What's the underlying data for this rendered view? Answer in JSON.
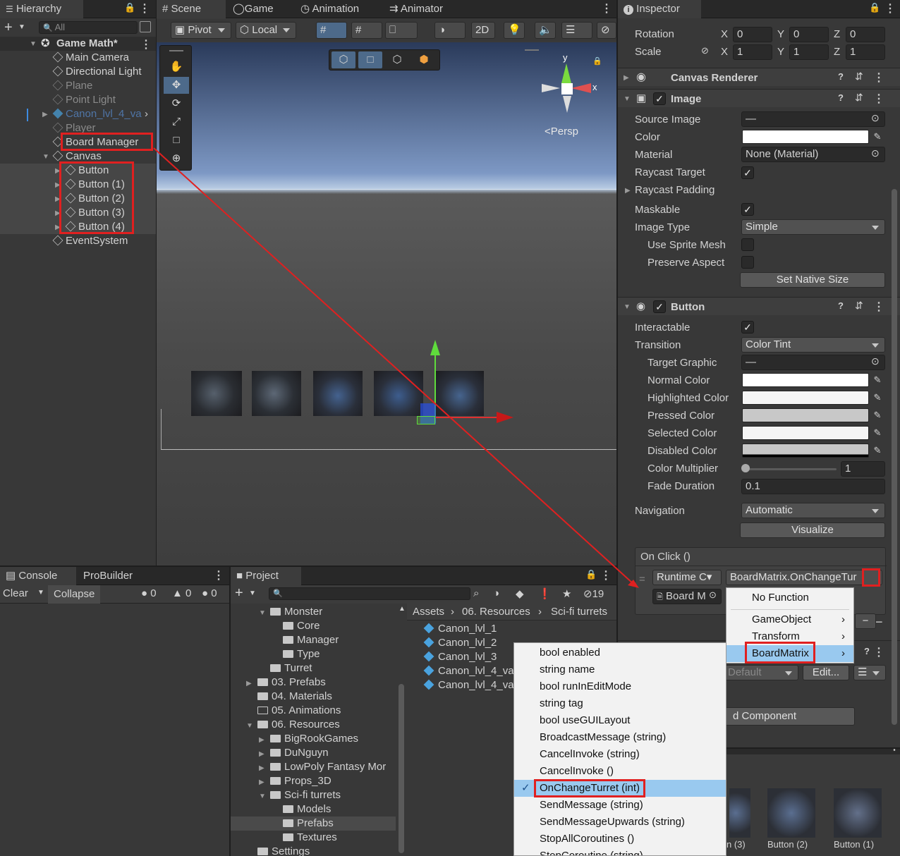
{
  "hierarchy": {
    "tab": "Hierarchy",
    "search_placeholder": "All",
    "scene_name": "Game Math*",
    "items": [
      {
        "label": "Main Camera"
      },
      {
        "label": "Directional Light"
      },
      {
        "label": "Plane"
      },
      {
        "label": "Point Light"
      },
      {
        "label": "Canon_lvl_4_va"
      },
      {
        "label": "Player"
      },
      {
        "label": "Board Manager"
      },
      {
        "label": "Canvas"
      },
      {
        "label": "Button"
      },
      {
        "label": "Button (1)"
      },
      {
        "label": "Button (2)"
      },
      {
        "label": "Button (3)"
      },
      {
        "label": "Button (4)"
      },
      {
        "label": "EventSystem"
      }
    ]
  },
  "scene": {
    "tabs": [
      "Scene",
      "Game",
      "Animation",
      "Animator"
    ],
    "pivot": "Pivot",
    "local": "Local",
    "mode_2d": "2D",
    "persp": "Persp",
    "gizmo_y": "y",
    "gizmo_x": "x"
  },
  "inspector": {
    "tab": "Inspector",
    "rotation_label": "Rotation",
    "rotation": {
      "x": "0",
      "y": "0",
      "z": "0"
    },
    "scale_label": "Scale",
    "scale": {
      "x": "1",
      "y": "1",
      "z": "1"
    },
    "axis": {
      "x": "X",
      "y": "Y",
      "z": "Z"
    },
    "canvas_renderer": "Canvas Renderer",
    "image": {
      "title": "Image",
      "source_image_label": "Source Image",
      "source_image_value": "—",
      "color_label": "Color",
      "material_label": "Material",
      "material_value": "None (Material)",
      "raycast_target_label": "Raycast Target",
      "raycast_padding_label": "Raycast Padding",
      "maskable_label": "Maskable",
      "image_type_label": "Image Type",
      "image_type_value": "Simple",
      "use_sprite_mesh_label": "Use Sprite Mesh",
      "preserve_aspect_label": "Preserve Aspect",
      "set_native_size": "Set Native Size"
    },
    "button": {
      "title": "Button",
      "interactable_label": "Interactable",
      "transition_label": "Transition",
      "transition_value": "Color Tint",
      "target_graphic_label": "Target Graphic",
      "target_graphic_value": "—",
      "normal_color_label": "Normal Color",
      "highlighted_color_label": "Highlighted Color",
      "pressed_color_label": "Pressed Color",
      "selected_color_label": "Selected Color",
      "disabled_color_label": "Disabled Color",
      "color_multiplier_label": "Color Multiplier",
      "color_multiplier_value": "1",
      "fade_duration_label": "Fade Duration",
      "fade_duration_value": "0.1",
      "navigation_label": "Navigation",
      "navigation_value": "Automatic",
      "visualize": "Visualize",
      "on_click_label": "On Click ()",
      "runtime_value": "Runtime C▾",
      "function_value": "BoardMatrix.OnChangeTur",
      "object_value": "Board M",
      "minus": "−"
    },
    "default_value": "Default",
    "edit_button": "Edit...",
    "add_component": "d Component"
  },
  "console": {
    "tabs": [
      "Console",
      "ProBuilder"
    ],
    "clear": "Clear",
    "collapse": "Collapse",
    "counts": {
      "info": "0",
      "warn": "0",
      "error": "0"
    }
  },
  "project": {
    "tab": "Project",
    "badge_count": "19",
    "breadcrumb": [
      "Assets",
      "06. Resources",
      "Sci-fi turrets"
    ],
    "tree": [
      {
        "label": "Monster"
      },
      {
        "label": "Core"
      },
      {
        "label": "Manager"
      },
      {
        "label": "Type"
      },
      {
        "label": "Turret"
      },
      {
        "label": "03. Prefabs"
      },
      {
        "label": "04. Materials"
      },
      {
        "label": "05. Animations"
      },
      {
        "label": "06. Resources"
      },
      {
        "label": "BigRookGames"
      },
      {
        "label": "DuNguyn"
      },
      {
        "label": "LowPoly Fantasy Mor"
      },
      {
        "label": "Props_3D"
      },
      {
        "label": "Sci-fi turrets"
      },
      {
        "label": "Models"
      },
      {
        "label": "Prefabs"
      },
      {
        "label": "Textures"
      },
      {
        "label": "Settings"
      }
    ],
    "files": [
      {
        "label": "Canon_lvl_1"
      },
      {
        "label": "Canon_lvl_2"
      },
      {
        "label": "Canon_lvl_3"
      },
      {
        "label": "Canon_lvl_4_va"
      },
      {
        "label": "Canon_lvl_4_va"
      }
    ],
    "thumbs": [
      {
        "label": "n (3)"
      },
      {
        "label": "Button (2)"
      },
      {
        "label": "Button (1)"
      }
    ]
  },
  "menu_object": {
    "items": [
      {
        "label": "No Function"
      },
      {
        "label": "GameObject"
      },
      {
        "label": "Transform"
      },
      {
        "label": "BoardMatrix"
      }
    ]
  },
  "menu_functions": {
    "items": [
      {
        "label": "bool enabled"
      },
      {
        "label": "string name"
      },
      {
        "label": "bool runInEditMode"
      },
      {
        "label": "string tag"
      },
      {
        "label": "bool useGUILayout"
      },
      {
        "label": "BroadcastMessage (string)"
      },
      {
        "label": "CancelInvoke (string)"
      },
      {
        "label": "CancelInvoke ()"
      },
      {
        "label": "OnChangeTurret (int)"
      },
      {
        "label": "SendMessage (string)"
      },
      {
        "label": "SendMessageUpwards (string)"
      },
      {
        "label": "StopAllCoroutines ()"
      },
      {
        "label": "StopCoroutine (string)"
      }
    ]
  },
  "colors": {
    "accent_selected": "#3e8be0",
    "annotation_red": "#e02020",
    "menu_highlight": "#99c9ef"
  }
}
